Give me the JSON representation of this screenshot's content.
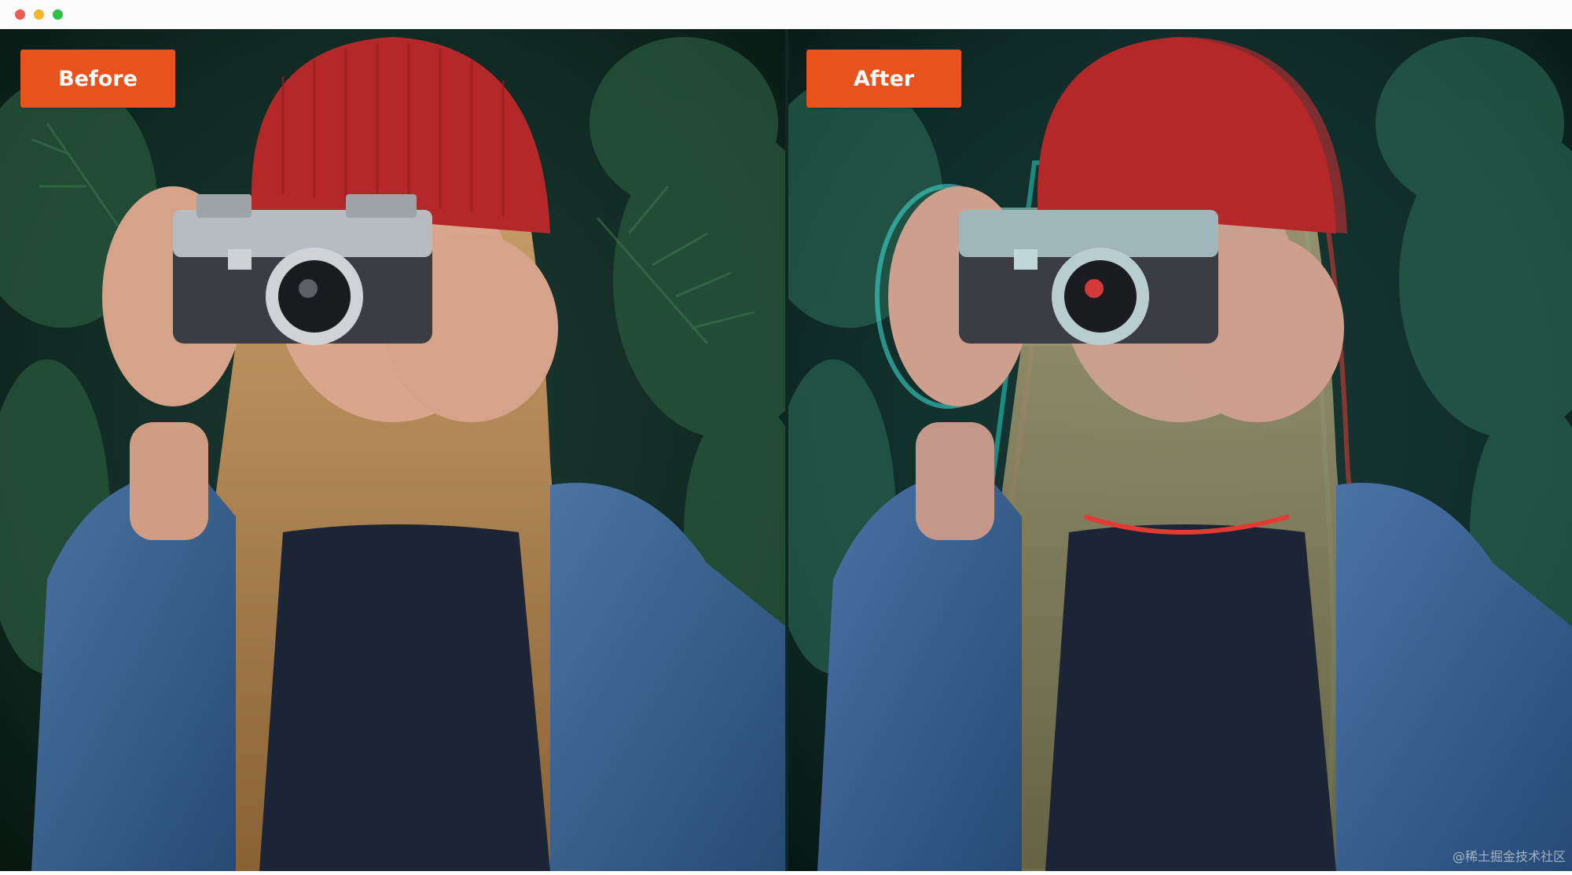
{
  "window": {
    "controls": [
      "close",
      "minimize",
      "zoom"
    ]
  },
  "panels": {
    "before": {
      "label": "Before",
      "image_icon": "woman-with-camera-photo"
    },
    "after": {
      "label": "After",
      "image_icon": "woman-with-camera-photo-rgb-split"
    }
  },
  "watermark": "@稀土掘金技术社区",
  "colors": {
    "label_bg": "#e8521d",
    "accent_red": "#e33b33",
    "accent_cyan": "#27d3c8",
    "forest_dark": "#0b2620",
    "denim": "#3d6592"
  }
}
